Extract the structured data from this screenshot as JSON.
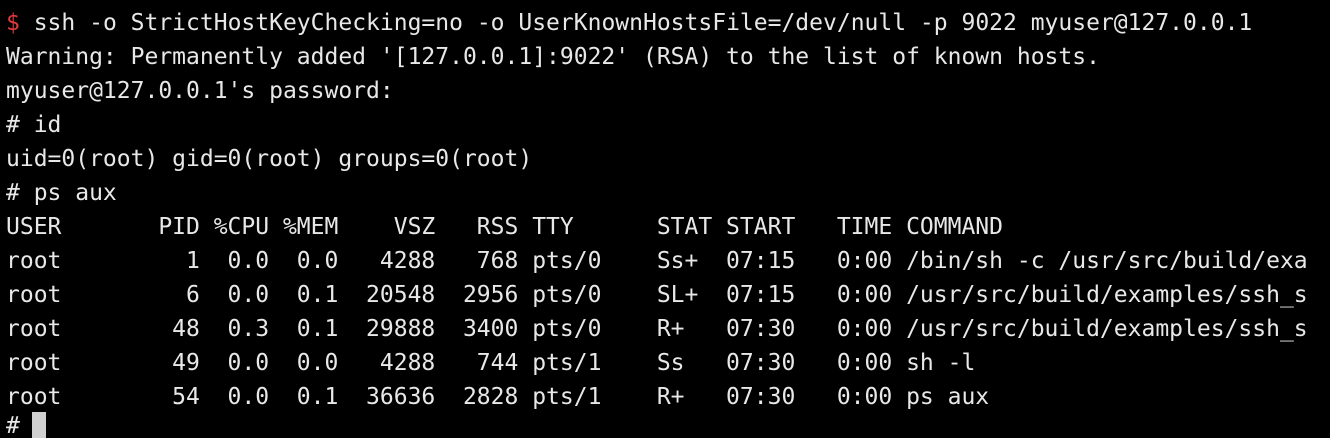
{
  "terminal": {
    "lines": [
      {
        "prompt": "$",
        "text": " ssh -o StrictHostKeyChecking=no -o UserKnownHostsFile=/dev/null -p 9022 myuser@127.0.0.1"
      },
      {
        "text": "Warning: Permanently added '[127.0.0.1]:9022' (RSA) to the list of known hosts."
      },
      {
        "text": "myuser@127.0.0.1's password:"
      },
      {
        "text": "# id"
      },
      {
        "text": "uid=0(root) gid=0(root) groups=0(root)"
      },
      {
        "text": "# ps aux"
      },
      {
        "text": "USER       PID %CPU %MEM    VSZ   RSS TTY      STAT START   TIME COMMAND"
      },
      {
        "text": "root         1  0.0  0.0   4288   768 pts/0    Ss+  07:15   0:00 /bin/sh -c /usr/src/build/exa"
      },
      {
        "text": "root         6  0.0  0.1  20548  2956 pts/0    SL+  07:15   0:00 /usr/src/build/examples/ssh_s"
      },
      {
        "text": "root        48  0.3  0.1  29888  3400 pts/0    R+   07:30   0:00 /usr/src/build/examples/ssh_s"
      },
      {
        "text": "root        49  0.0  0.0   4288   744 pts/1    Ss   07:30   0:00 sh -l"
      },
      {
        "text": "root        54  0.0  0.1  36636  2828 pts/1    R+   07:30   0:00 ps aux"
      }
    ],
    "current_prompt": "#",
    "colors": {
      "background": "#000000",
      "foreground": "#e8e8e8",
      "prompt_dollar": "#e03a3a",
      "cursor": "#d0d0d0"
    }
  }
}
